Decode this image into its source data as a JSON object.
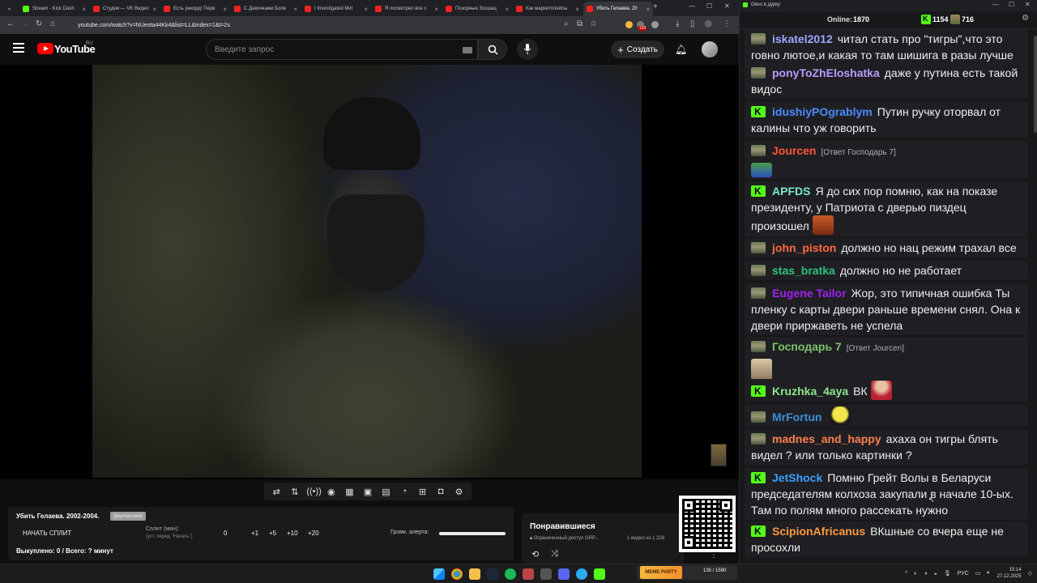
{
  "browser": {
    "tabs": [
      {
        "label": "Stream - Kick Dash",
        "color": "#53fc18"
      },
      {
        "label": "Студия — VK Видео",
        "color": "#e22"
      },
      {
        "label": "Есть рекорд! Перв",
        "color": "#e22"
      },
      {
        "label": "С Девочками Боле",
        "color": "#e22"
      },
      {
        "label": "I Investigated Mirr",
        "color": "#e22"
      },
      {
        "label": "Я посмотрел все с",
        "color": "#e22"
      },
      {
        "label": "Позорные Зоозащ",
        "color": "#e22"
      },
      {
        "label": "Как маркетплейсы",
        "color": "#e22"
      },
      {
        "label": "Убить Гелаева. 20",
        "color": "#e22"
      }
    ],
    "url": "youtube.com/watch?v=NUeota44Kk4&list=LL&index=1&t=2s",
    "ext_badge": "193"
  },
  "youtube": {
    "logo_text": "YouTube",
    "region": "RU",
    "search_placeholder": "Введите запрос",
    "create_label": "Создать"
  },
  "split": {
    "title": "Убить Гелаева. 2002-2004.",
    "badge": "Двухчасовой",
    "start_label": "НАЧАТЬ СПЛИТ",
    "minutes_label": "Сплит (мин):",
    "minutes_sub": "(уст. перед \"Начать\")",
    "minutes_value": "0",
    "buttons": [
      "+1",
      "+5",
      "+10",
      "+20"
    ],
    "volume_label": "Громк. алерта:",
    "volume_level": 1.0,
    "bought": "Выкуплено: 0 / Всего: ? минут"
  },
  "liked": {
    "title": "Понравившиеся",
    "access": "Ограниченный доступ GRP...",
    "count": "1 видео из 1 226"
  },
  "chat": {
    "window_title": "Окно в дурку",
    "online_label": "Online:",
    "online_value": "1870",
    "kick_count": "1154",
    "twitch_count": "716",
    "messages": [
      {
        "badge": "tank",
        "user": "iskatel2012",
        "color": "#9ea6ff",
        "text": "читал стать про \"тигры\",что это говно лютое,и какая то там шишига в разы лучше"
      },
      {
        "badge": "tank",
        "user": "ponyToZhEloshatka",
        "color": "#b89cff",
        "text": "даже у путина есть такой видос"
      },
      {
        "badge": "kick",
        "user": "idushiyPOgrablym",
        "color": "#4a8cff",
        "text": "Путин ручку оторвал от калины что уж говорить"
      },
      {
        "badge": "tank",
        "user": "Jourcen",
        "color": "#ff5733",
        "reply": "[Ответ Господарь 7]",
        "text": ""
      },
      {
        "badge": "kick",
        "user": "APFDS",
        "color": "#7ee6c9",
        "text": "Я до сих пор помню, как на показе президенту, у Патриота с дверью пиздец произошел"
      },
      {
        "badge": "tank",
        "user": "john_piston",
        "color": "#ff6a3d",
        "text": "должно но нац режим трахал все"
      },
      {
        "badge": "tank",
        "user": "stas_bratka",
        "color": "#2ec27e",
        "text": "должно но не работает"
      },
      {
        "badge": "tank",
        "user": "Eugene Tailor",
        "color": "#a020f0",
        "text": "Жор, это типичная ошибка Ты пленку с карты двери раньше времени снял. Она к двери приржаветь не успела"
      },
      {
        "badge": "tank",
        "user": "Господарь 7",
        "color": "#7cc36a",
        "reply": "[Ответ Jourcen]",
        "text": ""
      },
      {
        "badge": "kick",
        "user": "Kruzhka_4aya",
        "color": "#8fe48f",
        "text": "ВК"
      },
      {
        "badge": "tank",
        "user": "MrFortun",
        "color": "#3a8fd8",
        "text": ""
      },
      {
        "badge": "tank",
        "user": "madnes_and_happy",
        "color": "#ff7f50",
        "text": "ахаха он тигры блять видел ? или только картинки ?"
      },
      {
        "badge": "kick",
        "user": "JetShock",
        "color": "#3aa0ff",
        "text": "Помню Грейт Волы в Беларуси председателям колхоза закупали в начале 10-ых. Там по полям много рассекать нужно"
      },
      {
        "badge": "kick",
        "user": "ScipionAfricanus",
        "color": "#ff9a3c",
        "text": "ВКшные со вчера еще не просохли"
      }
    ]
  },
  "taskbar": {
    "lang": "РУС",
    "time": "15:14",
    "date": "27.12.2025",
    "media_brand": "MEME PARTY",
    "media_count": "135 / 1590"
  }
}
